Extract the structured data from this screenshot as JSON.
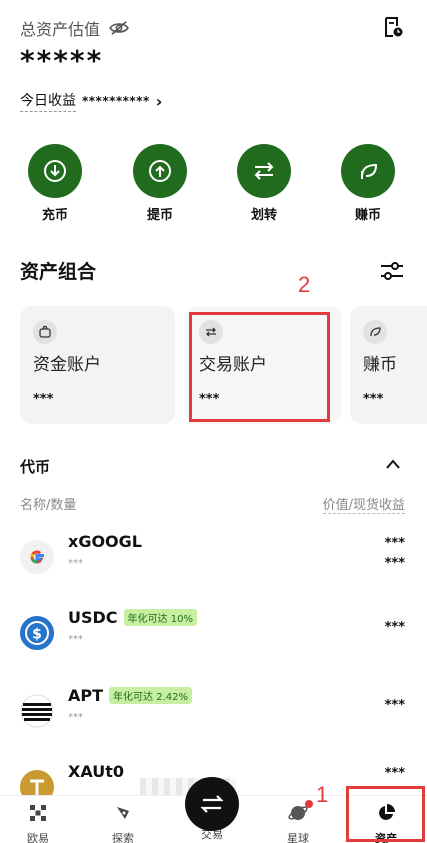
{
  "header": {
    "total_label": "总资产估值",
    "total_value": "*****",
    "today_label": "今日收益",
    "today_value": "**********"
  },
  "actions": [
    {
      "label": "充币",
      "icon": "deposit-icon"
    },
    {
      "label": "提币",
      "icon": "withdraw-icon"
    },
    {
      "label": "划转",
      "icon": "transfer-icon"
    },
    {
      "label": "赚币",
      "icon": "earn-icon"
    }
  ],
  "portfolio": {
    "title": "资产组合",
    "accounts": [
      {
        "name": "资金账户",
        "value": "***",
        "icon": "wallet-icon"
      },
      {
        "name": "交易账户",
        "value": "***",
        "icon": "swap-icon"
      },
      {
        "name": "赚币",
        "value": "***",
        "icon": "leaf-icon"
      }
    ]
  },
  "tokens": {
    "title": "代币",
    "col_left": "名称/数量",
    "col_right": "价值/现货收益",
    "items": [
      {
        "symbol": "xGOOGL",
        "badge": "",
        "amount": "***",
        "value": "***",
        "pnl": "***",
        "logo": "google-logo-icon"
      },
      {
        "symbol": "USDC",
        "badge": "年化可达 10%",
        "amount": "***",
        "value": "***",
        "pnl": "",
        "logo": "usdc-logo-icon"
      },
      {
        "symbol": "APT",
        "badge": "年化可达 2.42%",
        "amount": "***",
        "value": "***",
        "pnl": "",
        "logo": "apt-logo-icon"
      },
      {
        "symbol": "XAUt0",
        "badge": "",
        "amount": "",
        "value": "***",
        "pnl": "",
        "logo": "xaut-logo-icon"
      }
    ]
  },
  "tabbar": [
    {
      "label": "欧易",
      "icon": "okx-icon"
    },
    {
      "label": "探索",
      "icon": "compass-icon"
    },
    {
      "label": "交易",
      "icon": "trade-icon"
    },
    {
      "label": "星球",
      "icon": "planet-icon"
    },
    {
      "label": "资产",
      "icon": "pie-chart-icon"
    }
  ],
  "annotations": {
    "n1": "1",
    "n2": "2"
  },
  "colors": {
    "accent": "#216b1f",
    "badge_bg": "#c8ef9f",
    "annotation": "#e23b3b"
  }
}
